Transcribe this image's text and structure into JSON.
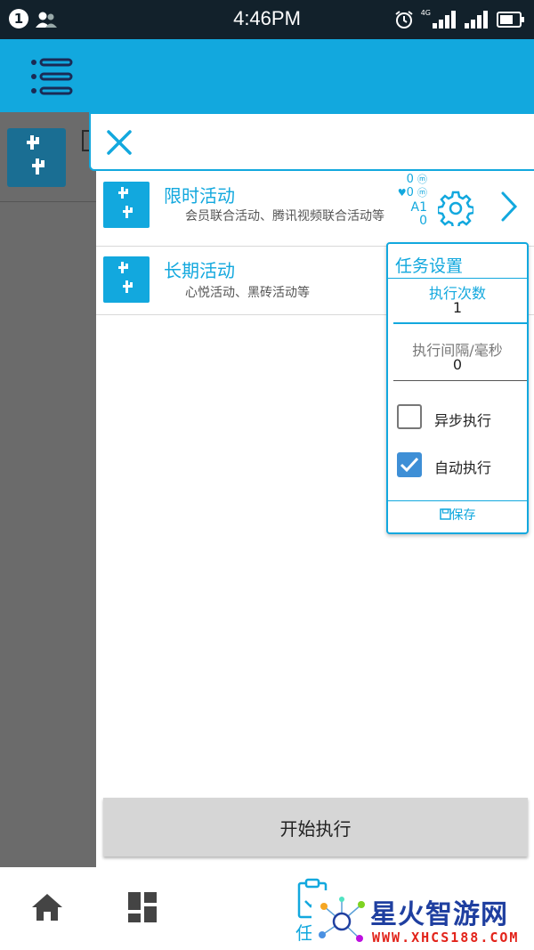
{
  "status_bar": {
    "notification_count": "1",
    "time": "4:46PM",
    "network_label": "4G",
    "icons": [
      "user-icon",
      "alarm-icon",
      "signal-icon",
      "signal-icon-2",
      "battery-icon"
    ]
  },
  "app_bar": {
    "icons": [
      "menu-list-icon"
    ]
  },
  "search_bar": {
    "icons": [
      "close-icon"
    ]
  },
  "activities": [
    {
      "title": "限时活动",
      "description": "会员联合活动、腾讯视频联合活动等",
      "stats": {
        "coin1": "0",
        "coin2": "0",
        "account": "A1",
        "count": "0"
      }
    },
    {
      "title": "长期活动",
      "description": "心悦活动、黑砖活动等"
    }
  ],
  "task_settings": {
    "title": "任务设置",
    "exec_count_label": "执行次数",
    "exec_count_value": "1",
    "interval_label": "执行间隔/毫秒",
    "interval_value": "0",
    "async_label": "异步执行",
    "async_checked": false,
    "auto_label": "自动执行",
    "auto_checked": true,
    "save_label": "保存"
  },
  "start_button": {
    "label": "开始执行"
  },
  "bottom_nav": {
    "task_label": "任"
  },
  "watermark": {
    "title": "星火智游网",
    "url": "WWW.XHCS188.COM"
  },
  "colors": {
    "accent": "#12a8de",
    "status_bar": "#12212b",
    "checkbox_checked": "#3e8fd6",
    "overlay": "#6b6b6b"
  }
}
